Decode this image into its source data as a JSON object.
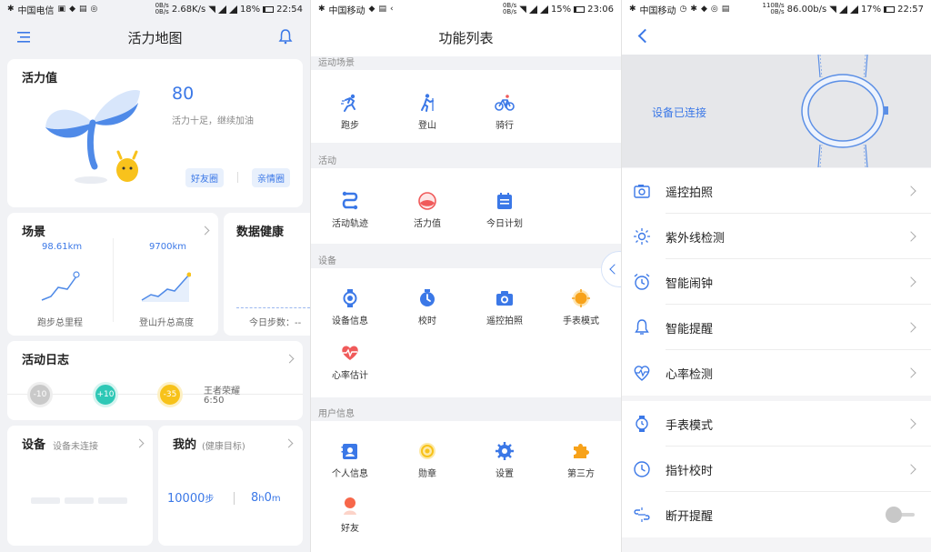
{
  "panel1": {
    "status": {
      "carrier": "中国电信",
      "net": [
        "0B/s",
        "0B/s"
      ],
      "speed": "2.68K/s",
      "battery": "18%",
      "time": "22:54"
    },
    "title": "活力地图",
    "vitality": {
      "title": "活力值",
      "value": "80",
      "desc": "活力十足，继续加油",
      "tab_friends": "好友圈",
      "tab_family": "亲情圈"
    },
    "scene": {
      "title": "场景",
      "run_value": "98.61km",
      "run_label": "跑步总里程",
      "climb_value": "9700km",
      "climb_label": "登山升总高度"
    },
    "health": {
      "title": "数据健康",
      "steps_label": "今日步数：--"
    },
    "log": {
      "title": "活动日志",
      "items": [
        {
          "value": "-10"
        },
        {
          "value": "+10"
        },
        {
          "value": "-35"
        }
      ],
      "event_name": "王者荣耀",
      "event_time": "6:50"
    },
    "device": {
      "title": "设备",
      "status": "设备未连接"
    },
    "mine": {
      "title": "我的",
      "goal_label": "(健康目标)",
      "steps_num": "10000",
      "steps_unit": "步",
      "hours_num": "8",
      "hours_unit": "h",
      "mins_num": "0",
      "mins_unit": "m"
    }
  },
  "panel2": {
    "status": {
      "carrier": "中国移动",
      "net": [
        "0B/s",
        "0B/s"
      ],
      "battery": "15%",
      "time": "23:06"
    },
    "title": "功能列表",
    "sections": [
      {
        "label": "运动场景",
        "items": [
          "跑步",
          "登山",
          "骑行"
        ]
      },
      {
        "label": "活动",
        "items": [
          "活动轨迹",
          "活力值",
          "今日计划"
        ]
      },
      {
        "label": "设备",
        "items": [
          "设备信息",
          "校时",
          "遥控拍照",
          "手表模式",
          "心率估计"
        ]
      },
      {
        "label": "用户信息",
        "items": [
          "个人信息",
          "勋章",
          "设置",
          "第三方",
          "好友"
        ]
      }
    ]
  },
  "panel3": {
    "status": {
      "carrier": "中国移动",
      "net": [
        "110B/s",
        "0B/s"
      ],
      "speed": "86.00b/s",
      "battery": "17%",
      "time": "22:57"
    },
    "connected": "设备已连接",
    "rows": [
      "遥控拍照",
      "紫外线检测",
      "智能闹钟",
      "智能提醒",
      "心率检测",
      "手表模式",
      "指针校时",
      "断开提醒"
    ]
  },
  "colors": {
    "accent": "#3b78e7",
    "teal": "#2ec8b6",
    "yellow": "#f7c21a",
    "red": "#f05a5a",
    "orange": "#f7a21a"
  }
}
